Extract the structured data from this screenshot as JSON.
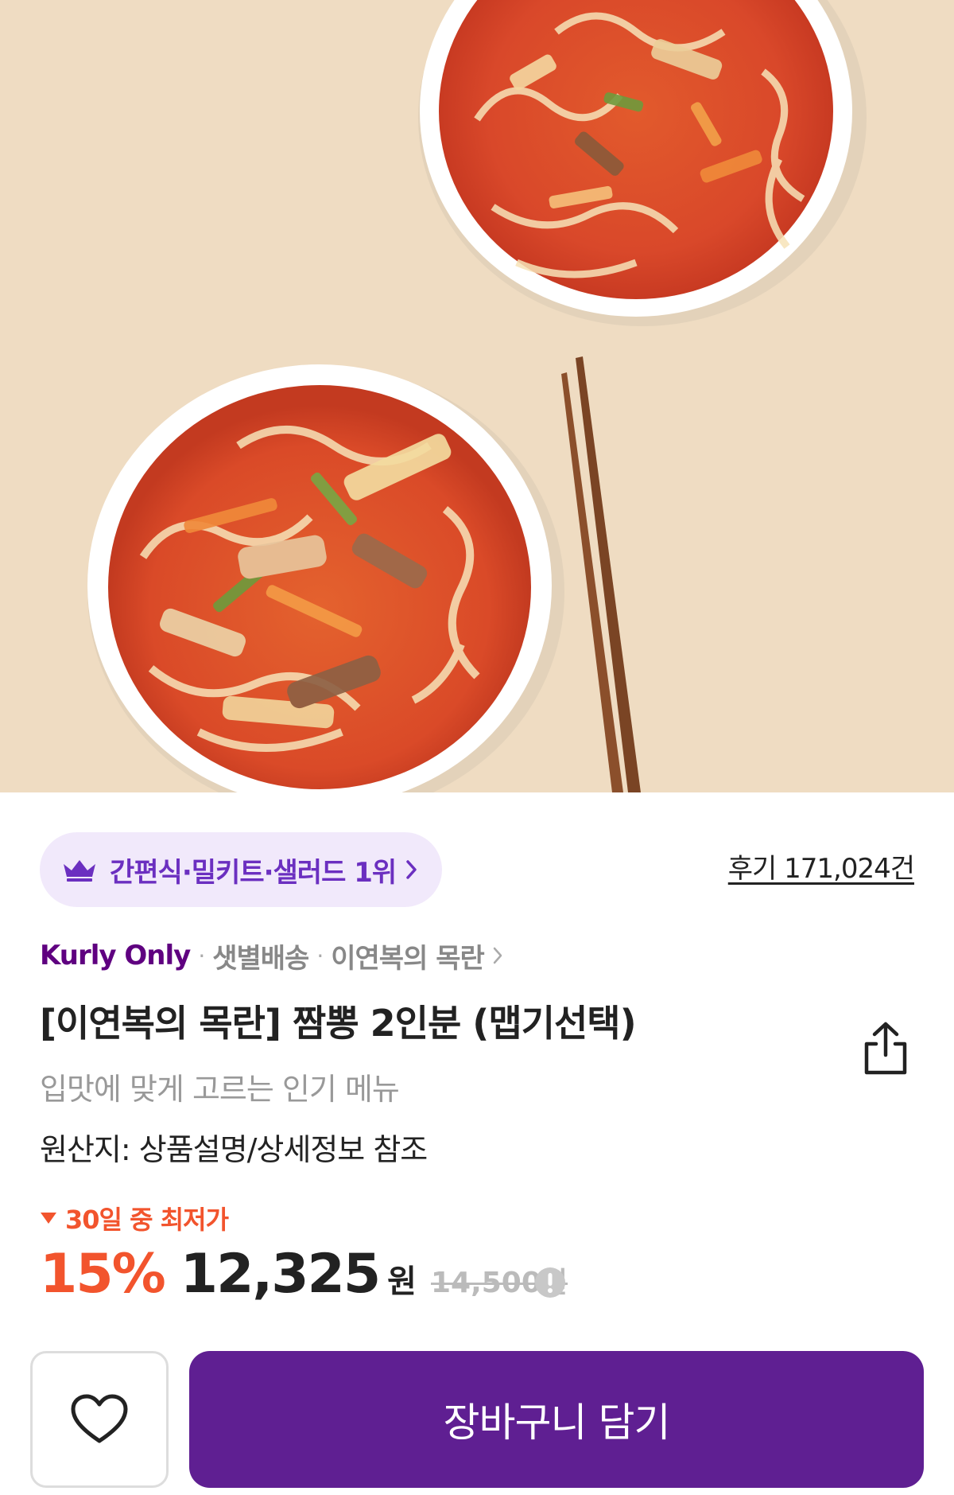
{
  "product": {
    "image_alt": "짬뽕 두 그릇과 젓가락"
  },
  "rank_badge": {
    "icon": "crown-icon",
    "label": "간편식·밀키트·샐러드 1위"
  },
  "reviews": {
    "label": "후기 171,024건"
  },
  "meta": {
    "brand": "Kurly Only",
    "separator": "·",
    "delivery": "샛별배송",
    "seller": "이연복의 목란"
  },
  "title": "[이연복의 목란] 짬뽕 2인분 (맵기선택)",
  "subtitle": "입맛에 맞게 고르는 인기 메뉴",
  "origin": "원산지: 상품설명/상세정보 참조",
  "price": {
    "lowest_label": "30일 중 최저가",
    "discount": "15%",
    "sale_price": "12,325",
    "currency": "원",
    "original_price": "14,500원"
  },
  "actions": {
    "wishlist_icon": "heart-icon",
    "cart_label": "장바구니 담기"
  },
  "colors": {
    "brand_purple": "#5f0080",
    "cart_button": "#5f1f92",
    "discount_orange": "#f2542d",
    "badge_bg": "#f1e9fb"
  }
}
